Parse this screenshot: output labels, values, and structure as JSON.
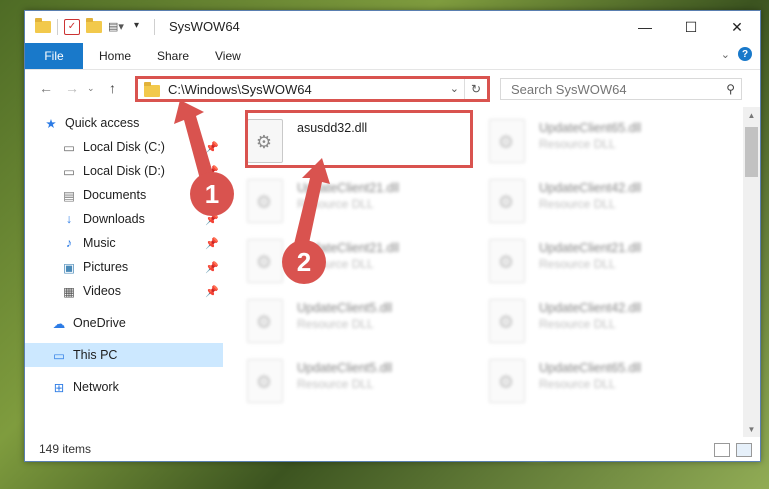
{
  "window": {
    "title": "SysWOW64",
    "controls": {
      "minimize": "—",
      "maximize": "☐",
      "close": "✕"
    }
  },
  "ribbon": {
    "file_tab": "File",
    "tabs": [
      "Home",
      "Share",
      "View"
    ]
  },
  "address_bar": {
    "path": "C:\\Windows\\SysWOW64"
  },
  "search": {
    "placeholder": "Search SysWOW64"
  },
  "nav_pane": {
    "items": [
      {
        "label": "Quick access",
        "icon": "star-icon",
        "pinned": false
      },
      {
        "label": "Local Disk (C:)",
        "icon": "drive-icon",
        "pinned": true
      },
      {
        "label": "Local Disk (D:)",
        "icon": "drive-icon",
        "pinned": true
      },
      {
        "label": "Documents",
        "icon": "documents-icon",
        "pinned": true
      },
      {
        "label": "Downloads",
        "icon": "download-icon",
        "pinned": true
      },
      {
        "label": "Music",
        "icon": "music-icon",
        "pinned": true
      },
      {
        "label": "Pictures",
        "icon": "pictures-icon",
        "pinned": true
      },
      {
        "label": "Videos",
        "icon": "videos-icon",
        "pinned": true
      },
      {
        "label": "OneDrive",
        "icon": "cloud-icon",
        "pinned": false
      },
      {
        "label": "This PC",
        "icon": "computer-icon",
        "pinned": false,
        "selected": true
      },
      {
        "label": "Network",
        "icon": "network-icon",
        "pinned": false
      }
    ]
  },
  "files": [
    {
      "name": "asusdd32.dll",
      "type": "",
      "highlighted": true
    },
    {
      "name": "UpdateClient65.dll",
      "type": "Resource DLL",
      "highlighted": false
    },
    {
      "name": "UpdateClient21.dll",
      "type": "Resource DLL",
      "highlighted": false
    },
    {
      "name": "UpdateClient42.dll",
      "type": "Resource DLL",
      "highlighted": false
    },
    {
      "name": "UpdateClient21.dll",
      "type": "Resource DLL",
      "highlighted": false
    },
    {
      "name": "UpdateClient21.dll",
      "type": "Resource DLL",
      "highlighted": false
    },
    {
      "name": "UpdateClient5.dll",
      "type": "Resource DLL",
      "highlighted": false
    },
    {
      "name": "UpdateClient42.dll",
      "type": "Resource DLL",
      "highlighted": false
    },
    {
      "name": "UpdateClient5.dll",
      "type": "Resource DLL",
      "highlighted": false
    },
    {
      "name": "UpdateClient65.dll",
      "type": "Resource DLL",
      "highlighted": false
    }
  ],
  "status_bar": {
    "item_count": "149 items"
  },
  "annotations": {
    "badge_1": "1",
    "badge_2": "2",
    "color": "#d9534f"
  }
}
